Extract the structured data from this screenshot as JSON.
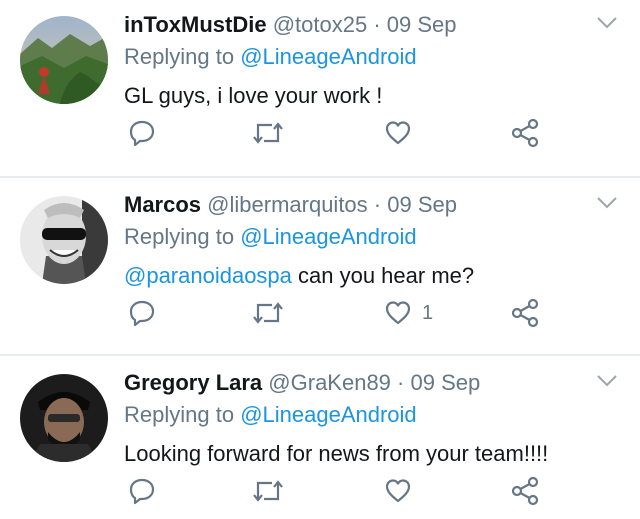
{
  "tweets": [
    {
      "name": "inToxMustDie",
      "handle": "@totox25",
      "separator": "·",
      "date": "09 Sep",
      "replying_prefix": "Replying to",
      "replying_to": "@LineageAndroid",
      "mention": "",
      "text": "GL guys, i love your work !",
      "like_count": ""
    },
    {
      "name": "Marcos",
      "handle": "@libermarquitos",
      "separator": "·",
      "date": "09 Sep",
      "replying_prefix": "Replying to",
      "replying_to": "@LineageAndroid",
      "mention": "@paranoidaospa",
      "text": " can you hear me?",
      "like_count": "1"
    },
    {
      "name": "Gregory Lara",
      "handle": "@GraKen89",
      "separator": "·",
      "date": "09 Sep",
      "replying_prefix": "Replying to",
      "replying_to": "@LineageAndroid",
      "mention": "",
      "text": "Looking forward for news from your team!!!!",
      "like_count": ""
    }
  ],
  "icons": {
    "reply": "reply-icon",
    "retweet": "retweet-icon",
    "like": "heart-icon",
    "share": "share-icon",
    "more": "chevron-down-icon"
  },
  "colors": {
    "name": "#14171a",
    "secondary": "#657786",
    "link": "#1b95e0",
    "divider": "#e6ecf0"
  }
}
